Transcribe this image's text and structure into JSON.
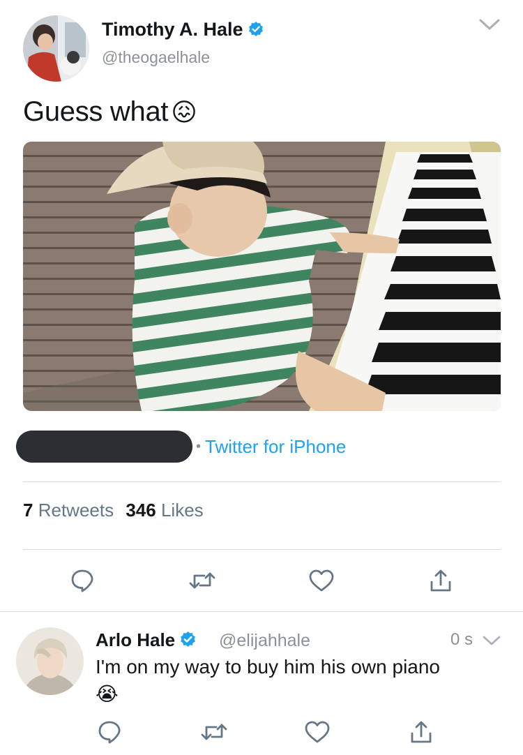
{
  "tweet": {
    "author_name": "Timothy A. Hale",
    "author_handle": "@theogaelhale",
    "text": "Guess what",
    "emoji": "😖",
    "source_separator": "•",
    "source": "Twitter for iPhone",
    "retweets_count": "7",
    "retweets_label": "Retweets",
    "likes_count": "346",
    "likes_label": "Likes"
  },
  "reply": {
    "author_name": "Arlo Hale",
    "author_handle": "@elijahhale",
    "timestamp": "0 s",
    "text": "I'm on my way to buy him his own piano",
    "emoji": "😭"
  },
  "icons": {
    "verified": "verified-badge-icon",
    "menu": "chevron-down-icon",
    "reply": "reply-bubble-icon",
    "retweet": "retweet-icon",
    "like": "heart-icon",
    "share": "share-upload-icon"
  },
  "colors": {
    "link_blue": "#1da1f2",
    "verified_blue": "#1da1f2",
    "secondary_text": "#8a9199",
    "icon_gray": "#657786",
    "redaction_bar": "#2b2f33"
  }
}
